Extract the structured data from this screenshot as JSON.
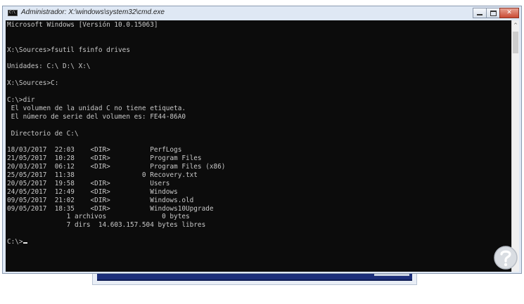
{
  "window": {
    "title": "Administrador: X:\\windows\\system32\\cmd.exe",
    "icon": "cmd-icon",
    "buttons": {
      "minimize": "minimize-icon",
      "maximize": "maximize-icon",
      "close": "close-icon",
      "close_glyph": "✕"
    }
  },
  "console": {
    "text_color": "#c8c8c8",
    "background": "#0c0c0c",
    "lines": [
      "Microsoft Windows [Versión 10.0.15063]",
      "",
      "",
      "X:\\Sources>fsutil fsinfo drives",
      "",
      "Unidades: C:\\ D:\\ X:\\",
      "",
      "X:\\Sources>C:",
      "",
      "C:\\>dir",
      " El volumen de la unidad C no tiene etiqueta.",
      " El número de serie del volumen es: FE44-86A0",
      "",
      " Directorio de C:\\",
      "",
      "18/03/2017  22:03    <DIR>          PerfLogs",
      "21/05/2017  10:28    <DIR>          Program Files",
      "20/03/2017  06:12    <DIR>          Program Files (x86)",
      "25/05/2017  11:38                 0 Recovery.txt",
      "20/05/2017  19:58    <DIR>          Users",
      "24/05/2017  12:49    <DIR>          Windows",
      "09/05/2017  21:02    <DIR>          Windows.old",
      "09/05/2017  18:35    <DIR>          Windows10Upgrade",
      "               1 archivos              0 bytes",
      "               7 dirs  14.603.157.504 bytes libres",
      "",
      "C:\\>"
    ]
  },
  "scrollbar": {
    "up_arrow": "chevron-up-icon",
    "up_glyph": "^"
  },
  "watermark": {
    "icon": "watermark-logo-icon"
  }
}
